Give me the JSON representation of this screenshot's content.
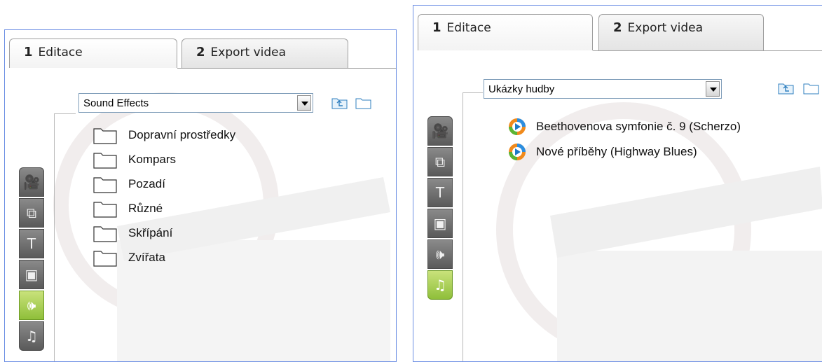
{
  "left_panel": {
    "tabs": [
      {
        "num": "1",
        "label": "Editace"
      },
      {
        "num": "2",
        "label": "Export videa"
      }
    ],
    "dropdown_value": "Sound Effects",
    "folders": [
      "Dopravní prostředky",
      "Kompars",
      "Pozadí",
      "Různé",
      "Skřípání",
      "Zvířata"
    ],
    "sidebar": [
      {
        "icon": "video-camera-icon",
        "glyph": "🎥"
      },
      {
        "icon": "transition-icon",
        "glyph": "⧉"
      },
      {
        "icon": "title-text-icon",
        "glyph": "T"
      },
      {
        "icon": "photo-icon",
        "glyph": "▣"
      },
      {
        "icon": "sound-effects-icon",
        "glyph": "🕪",
        "active": true
      },
      {
        "icon": "music-icon",
        "glyph": "♫"
      }
    ]
  },
  "right_panel": {
    "tabs": [
      {
        "num": "1",
        "label": "Editace"
      },
      {
        "num": "2",
        "label": "Export videa"
      }
    ],
    "dropdown_value": "Ukázky hudby",
    "tracks": [
      "Beethovenova symfonie č. 9 (Scherzo)",
      "Nové příběhy (Highway Blues)"
    ],
    "sidebar": [
      {
        "icon": "video-camera-icon",
        "glyph": "🎥"
      },
      {
        "icon": "transition-icon",
        "glyph": "⧉"
      },
      {
        "icon": "title-text-icon",
        "glyph": "T"
      },
      {
        "icon": "photo-icon",
        "glyph": "▣"
      },
      {
        "icon": "sound-effects-icon",
        "glyph": "🕪"
      },
      {
        "icon": "music-icon",
        "glyph": "♫",
        "active": true
      }
    ]
  },
  "colors": {
    "panel_border": "#6d8fe4",
    "sidebar_active": "#9cc63f",
    "sidebar_inactive": "#6e6e6e"
  }
}
